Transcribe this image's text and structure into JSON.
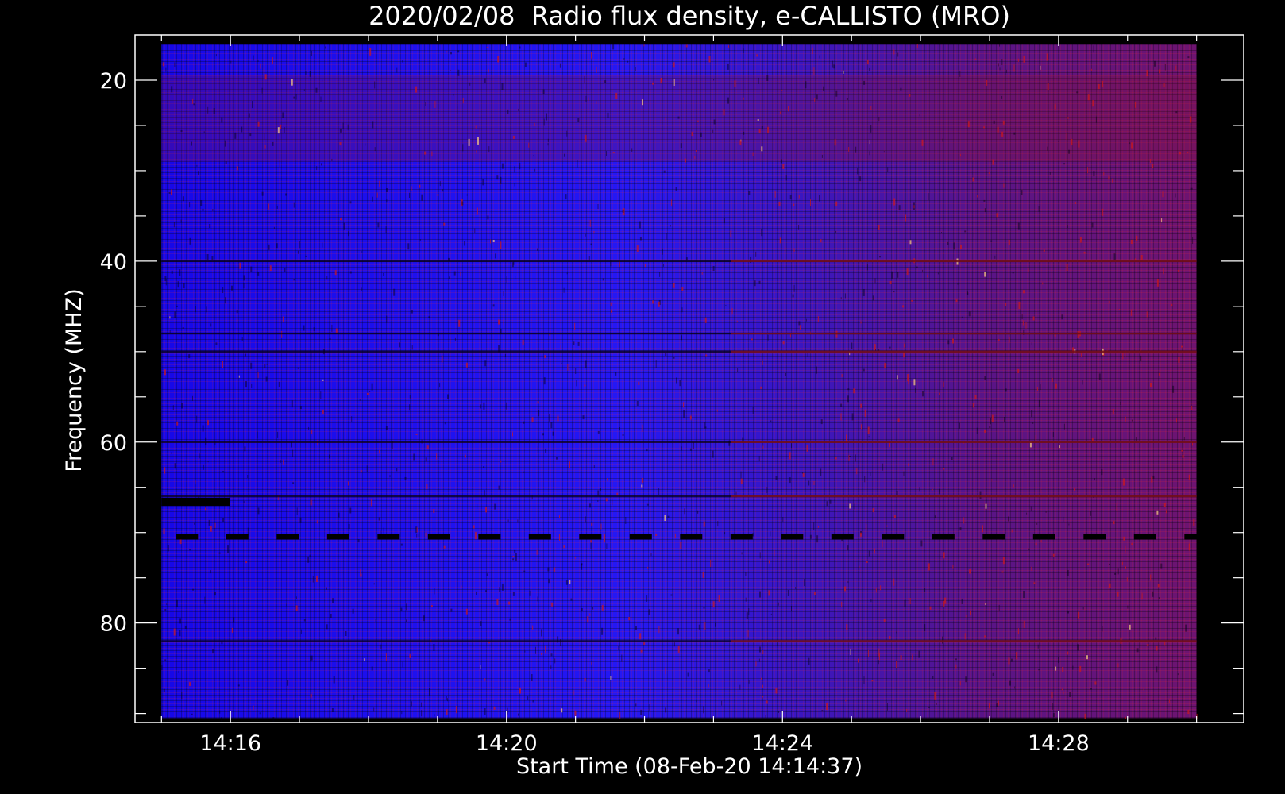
{
  "chart_data": {
    "type": "heatmap",
    "title": "2020/02/08  Radio flux density, e-CALLISTO (MRO)",
    "xlabel": "Start Time (08-Feb-20 14:14:37)",
    "ylabel": "Frequency (MHZ)",
    "x_tick_labels": [
      "14:16",
      "14:20",
      "14:24",
      "14:28"
    ],
    "y_tick_labels": [
      "20",
      "40",
      "60",
      "80"
    ],
    "xlim": [
      "14:14:37",
      "14:30:41"
    ],
    "ylim": [
      91,
      15
    ],
    "y_tick_values": [
      20,
      40,
      60,
      80
    ],
    "y_minor_tick_values": [
      25,
      30,
      35,
      45,
      50,
      55,
      65,
      70,
      75,
      85,
      90
    ],
    "colors": {
      "background": "#000000",
      "low_intensity": "#1a10ff",
      "high_intensity": "#c4141e",
      "axis": "#ffffff"
    },
    "data_region": {
      "time_start": "14:15:00",
      "time_end": "14:30:00",
      "freq_start": 16,
      "freq_end": 90.5
    },
    "features": [
      {
        "type": "horizontal-band",
        "freq": 40
      },
      {
        "type": "horizontal-band",
        "freq": 48
      },
      {
        "type": "horizontal-band",
        "freq": 50
      },
      {
        "type": "horizontal-band",
        "freq": 60
      },
      {
        "type": "horizontal-band",
        "freq": 66
      },
      {
        "type": "dashed-gap",
        "freq": 70.5
      },
      {
        "type": "horizontal-band",
        "freq": 82
      }
    ]
  }
}
